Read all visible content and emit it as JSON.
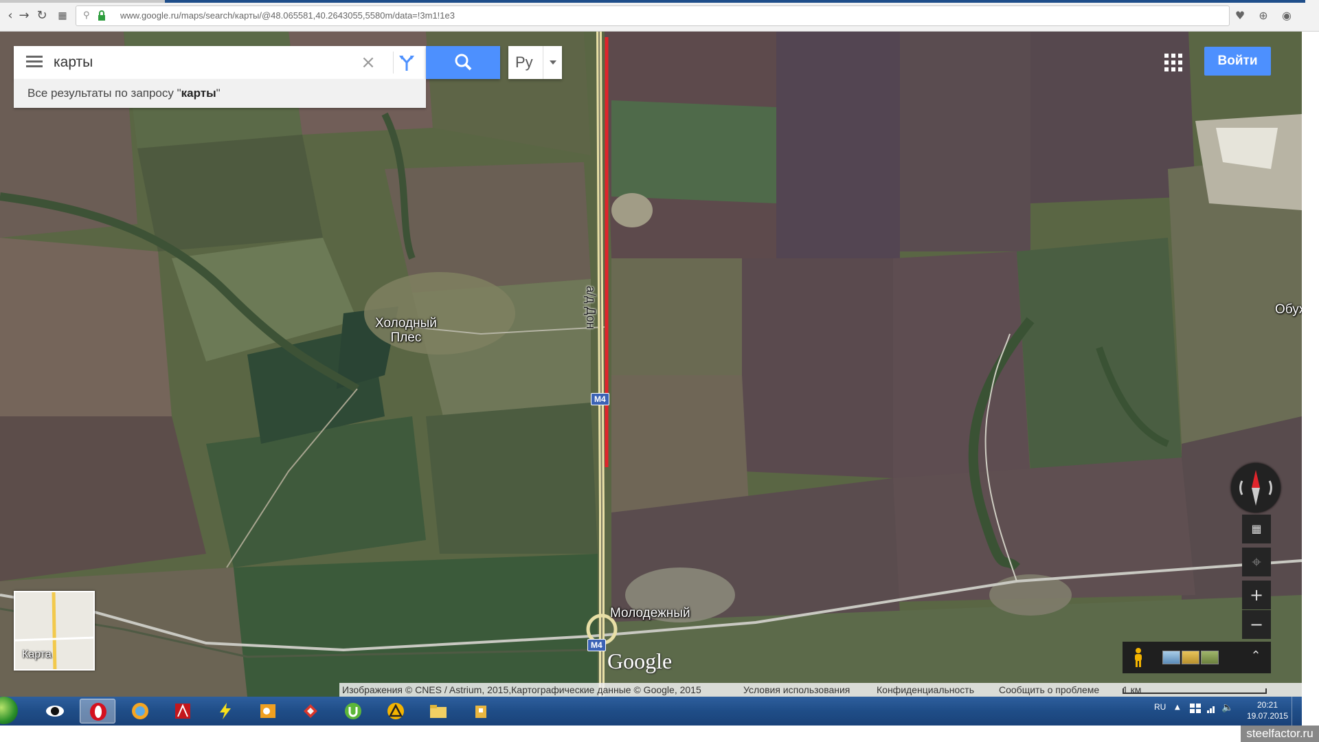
{
  "browser": {
    "url": "www.google.ru/maps/search/карты/@48.065581,40.2643055,5580m/data=!3m1!1e3",
    "back_icon": "back-arrow-icon",
    "forward_icon": "forward-arrow-icon",
    "reload_icon": "reload-icon",
    "apps_icon": "speed-dial-icon"
  },
  "search": {
    "query": "карты",
    "menu_icon": "hamburger-menu-icon",
    "clear_icon": "close-icon",
    "directions_icon": "directions-icon",
    "search_icon": "magnifier-icon",
    "lang_label": "Ру",
    "results_prefix": "Все результаты по запросу \"",
    "results_query": "карты",
    "results_suffix": "\""
  },
  "header": {
    "login_label": "Войти"
  },
  "map": {
    "places": [
      {
        "name": "Холодный",
        "line2": "Плес"
      },
      {
        "name": "Молодежный"
      },
      {
        "name": "Обух"
      }
    ],
    "road_name": "а/д Дон",
    "route_badge_1": "M4",
    "route_badge_2": "M4",
    "highlight_color": "#e0242b",
    "google_logo": "Google",
    "minimap_label": "Карта"
  },
  "attribution": {
    "imagery": "Изображения © CNES / Astrium, 2015,Картографические данные © Google, 2015",
    "terms": "Условия использования",
    "privacy": "Конфиденциальность",
    "report": "Сообщить о проблеме",
    "scale": "1 км"
  },
  "taskbar": {
    "language": "RU",
    "time": "20:21",
    "date": "19.07.2015"
  },
  "watermark": "steelfactor.ru",
  "colors": {
    "accent": "#4d90fe",
    "taskbar": "#1f4d87"
  }
}
